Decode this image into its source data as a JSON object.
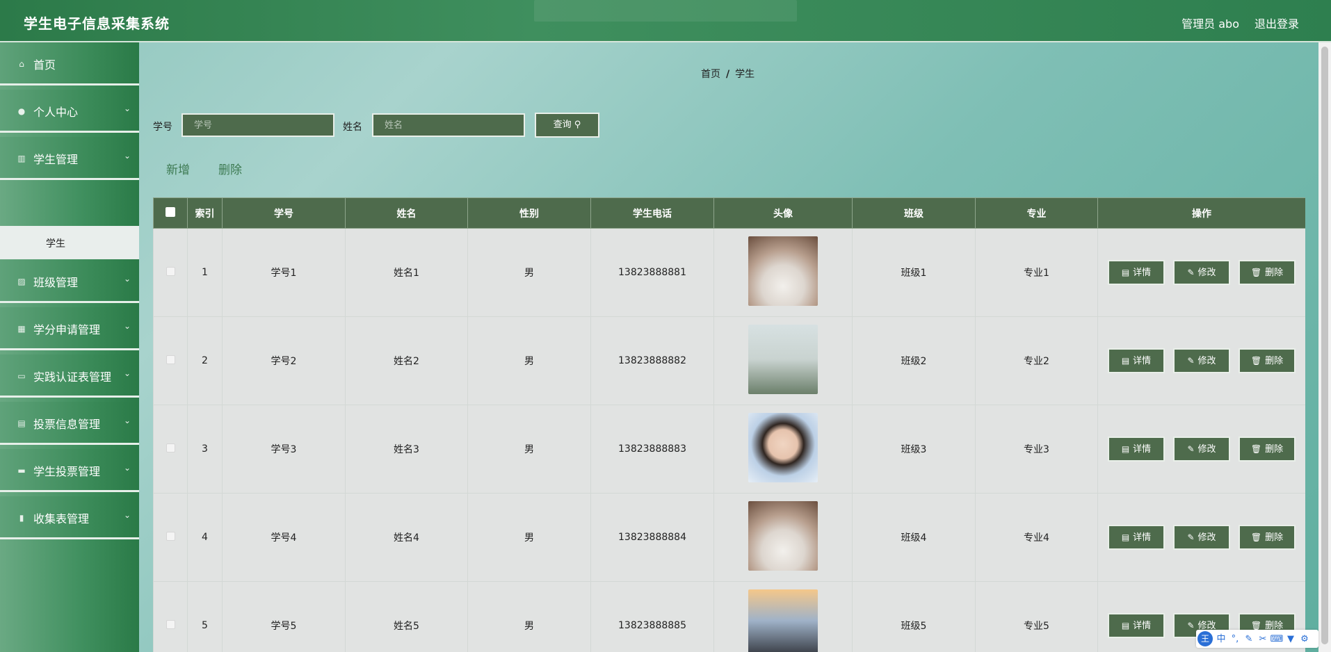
{
  "header": {
    "title": "学生电子信息采集系统",
    "user": "管理员 abo",
    "logout": "退出登录"
  },
  "sidebar": {
    "items": [
      {
        "label": "首页",
        "icon": "home-icon",
        "glyph": "⌂",
        "arrow": ""
      },
      {
        "label": "个人中心",
        "icon": "user-icon",
        "glyph": "●",
        "arrow": "⌄"
      },
      {
        "label": "学生管理",
        "icon": "bar-chart-icon",
        "glyph": "▥",
        "arrow": "⌄"
      },
      {
        "label": "班级管理",
        "icon": "picture-icon",
        "glyph": "▨",
        "arrow": "⌄"
      },
      {
        "label": "学分申请管理",
        "icon": "grid-icon",
        "glyph": "▦",
        "arrow": "⌄"
      },
      {
        "label": "实践认证表管理",
        "icon": "monitor-icon",
        "glyph": "▭",
        "arrow": "⌄"
      },
      {
        "label": "投票信息管理",
        "icon": "lock-icon",
        "glyph": "▤",
        "arrow": "⌄"
      },
      {
        "label": "学生投票管理",
        "icon": "comment-icon",
        "glyph": "▬",
        "arrow": "⌄"
      },
      {
        "label": "收集表管理",
        "icon": "clipboard-icon",
        "glyph": "▮",
        "arrow": "⌄"
      }
    ],
    "submenu": "学生"
  },
  "breadcrumb": {
    "home": "首页",
    "sep": "/",
    "current": "学生"
  },
  "search": {
    "id_label": "学号",
    "id_placeholder": "学号",
    "name_label": "姓名",
    "name_placeholder": "姓名",
    "query": "查询 ⚲"
  },
  "actions": {
    "add": "新增",
    "delete": "删除"
  },
  "table": {
    "headers": [
      "索引",
      "学号",
      "姓名",
      "性别",
      "学生电话",
      "头像",
      "班级",
      "专业",
      "操作"
    ],
    "rows": [
      {
        "index": "1",
        "id": "学号1",
        "name": "姓名1",
        "gender": "男",
        "phone": "13823888881",
        "class": "班级1",
        "major": "专业1"
      },
      {
        "index": "2",
        "id": "学号2",
        "name": "姓名2",
        "gender": "男",
        "phone": "13823888882",
        "class": "班级2",
        "major": "专业2"
      },
      {
        "index": "3",
        "id": "学号3",
        "name": "姓名3",
        "gender": "男",
        "phone": "13823888883",
        "class": "班级3",
        "major": "专业3"
      },
      {
        "index": "4",
        "id": "学号4",
        "name": "姓名4",
        "gender": "男",
        "phone": "13823888884",
        "class": "班级4",
        "major": "专业4"
      },
      {
        "index": "5",
        "id": "学号5",
        "name": "姓名5",
        "gender": "男",
        "phone": "13823888885",
        "class": "班级5",
        "major": "专业5"
      }
    ],
    "ops": {
      "detail": "详情",
      "edit": "修改",
      "remove": "删除"
    }
  },
  "ime": {
    "logo": "王",
    "mode": "中"
  }
}
